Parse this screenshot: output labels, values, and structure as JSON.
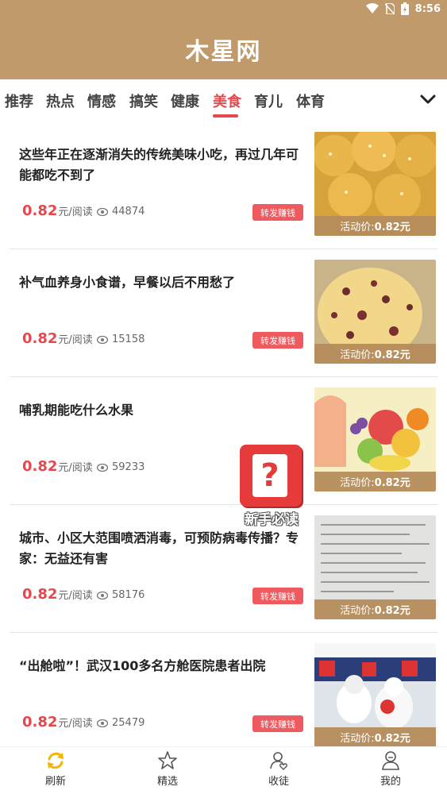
{
  "status_bar": {
    "time": "8:56"
  },
  "header": {
    "title": "木星网"
  },
  "tabs": [
    {
      "label": "推荐"
    },
    {
      "label": "热点"
    },
    {
      "label": "情感"
    },
    {
      "label": "搞笑"
    },
    {
      "label": "健康"
    },
    {
      "label": "美食"
    },
    {
      "label": "育儿"
    },
    {
      "label": "体育"
    }
  ],
  "active_tab": "美食",
  "accent_color": "#e5484d",
  "header_color": "#c19a6b",
  "articles": [
    {
      "title": "这些年正在逐渐消失的传统美味小吃，再过几年可能都吃不到了",
      "price": "0.82",
      "unit": "元/阅读",
      "views": "44874",
      "share": "转发赚钱",
      "tag_prefix": "活动价:",
      "tag_price": "0.82元"
    },
    {
      "title": "补气血养身小食谱，早餐以后不用愁了",
      "price": "0.82",
      "unit": "元/阅读",
      "views": "15158",
      "share": "转发赚钱",
      "tag_prefix": "活动价:",
      "tag_price": "0.82元"
    },
    {
      "title": "哺乳期能吃什么水果",
      "price": "0.82",
      "unit": "元/阅读",
      "views": "59233",
      "share": "",
      "tag_prefix": "活动价:",
      "tag_price": "0.82元"
    },
    {
      "title": "城市、小区大范围喷洒消毒，可预防病毒传播？专家：无益还有害",
      "price": "0.82",
      "unit": "元/阅读",
      "views": "58176",
      "share": "转发赚钱",
      "tag_prefix": "活动价:",
      "tag_price": "0.82元"
    },
    {
      "title": "“出舱啦”！武汉100多名方舱医院患者出院",
      "price": "0.82",
      "unit": "元/阅读",
      "views": "25479",
      "share": "转发赚钱",
      "tag_prefix": "活动价:",
      "tag_price": "0.82元"
    }
  ],
  "float_help": {
    "label": "新手必读",
    "icon": "question-icon"
  },
  "bottom_nav": [
    {
      "label": "刷新",
      "icon": "refresh-icon"
    },
    {
      "label": "精选",
      "icon": "star-icon"
    },
    {
      "label": "收徒",
      "icon": "apprentice-icon"
    },
    {
      "label": "我的",
      "icon": "profile-icon"
    }
  ]
}
